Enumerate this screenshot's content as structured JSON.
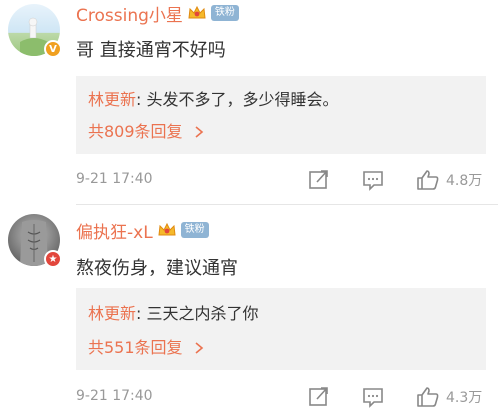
{
  "comments": [
    {
      "username": "Crossing小星",
      "fan_tag": "铁粉",
      "text": "哥 直接通宵不好吗",
      "reply": {
        "author": "林更新",
        "colon": ": ",
        "text": "头发不多了，多少得睡会。"
      },
      "more_replies": "共809条回复",
      "time": "9-21 17:40",
      "likes": "4.8万",
      "badge_color": "#f0a020"
    },
    {
      "username": "偏执狂-xL",
      "fan_tag": "铁粉",
      "text": "熬夜伤身，建议通宵",
      "reply": {
        "author": "林更新",
        "colon": ": ",
        "text": "三天之内杀了你"
      },
      "more_replies": "共551条回复",
      "time": "9-21 17:40",
      "likes": "4.3万",
      "badge_color": "#e2463c"
    }
  ],
  "icons": {
    "arrow": "chevron-right-icon",
    "share": "share-icon",
    "comment": "comment-icon",
    "like": "like-icon"
  }
}
